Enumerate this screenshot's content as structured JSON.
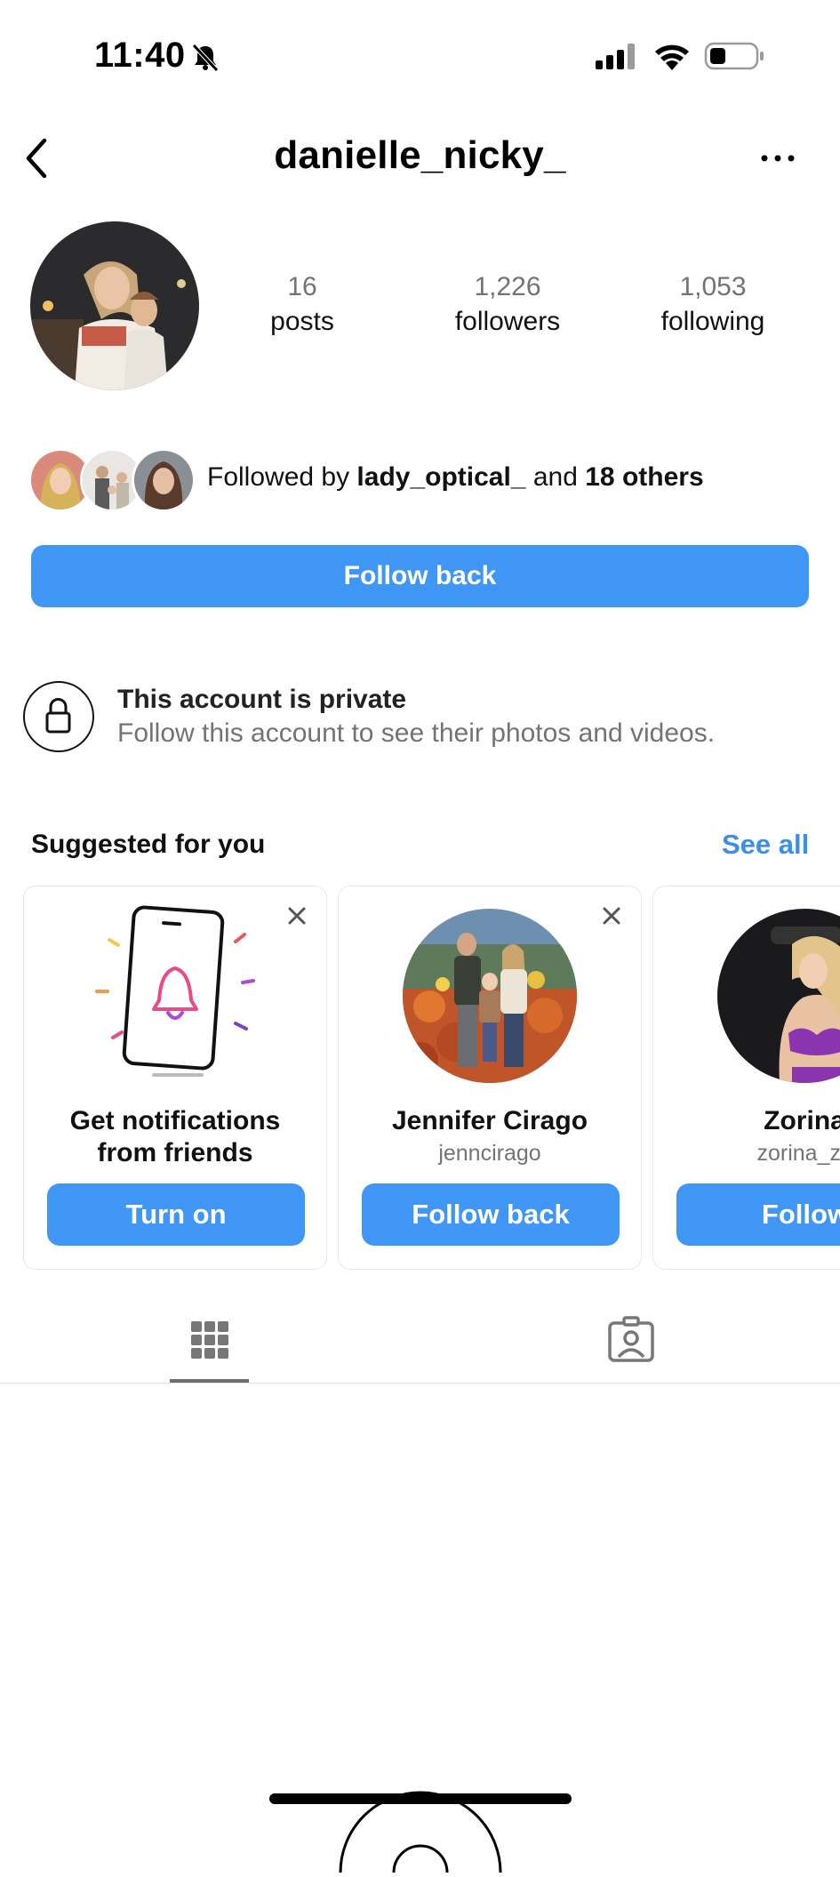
{
  "status_bar": {
    "time": "11:40",
    "icons": [
      "bell-slash-icon",
      "cellular-signal-icon",
      "wifi-icon",
      "battery-icon"
    ]
  },
  "header": {
    "username": "danielle_nicky_",
    "back_icon": "chevron-left-icon",
    "more_icon": "ellipsis-icon"
  },
  "profile": {
    "stats": [
      {
        "value": "16",
        "label": "posts"
      },
      {
        "value": "1,226",
        "label": "followers"
      },
      {
        "value": "1,053",
        "label": "following"
      }
    ],
    "followed_by": {
      "prefix": "Followed by ",
      "user": "lady_optical_",
      "middle": " and ",
      "others": "18 others"
    },
    "follow_back_label": "Follow back"
  },
  "private_notice": {
    "title": "This account is private",
    "subtitle": "Follow this account to see their photos and videos."
  },
  "suggested": {
    "title": "Suggested for you",
    "see_all": "See all",
    "cards": [
      {
        "name_line1": "Get notifications",
        "name_line2": "from friends",
        "button": "Turn on"
      },
      {
        "name": "Jennifer Cirago",
        "handle": "jenncirago",
        "button": "Follow back"
      },
      {
        "name": "Zorina",
        "handle": "zorina_zc",
        "button": "Follow"
      }
    ]
  },
  "tabs": {
    "items": [
      "grid-icon",
      "tagged-icon"
    ],
    "active": "grid-icon"
  },
  "colors": {
    "accent": "#4096f5",
    "link": "#3b8fe8",
    "muted_text": "#737373"
  }
}
